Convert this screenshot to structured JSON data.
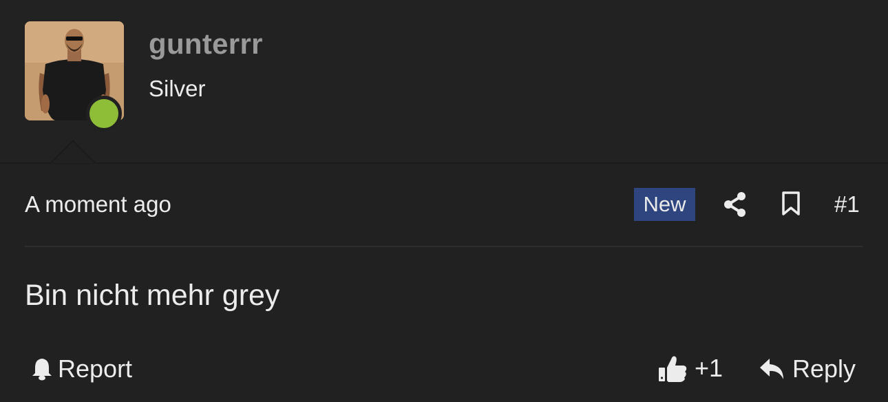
{
  "author": {
    "username": "gunterrr",
    "rank": "Silver",
    "avatar_icon": "user-avatar-photo",
    "online_status_color": "#8ebd37"
  },
  "meta": {
    "timestamp": "A moment ago",
    "new_badge": "New",
    "new_badge_color": "#2f4580",
    "post_number": "#1",
    "share_icon": "share-icon",
    "bookmark_icon": "bookmark-icon"
  },
  "post": {
    "message": "Bin nicht mehr grey"
  },
  "actions": {
    "report_label": "Report",
    "report_icon": "bell-icon",
    "like_count": "+1",
    "like_icon": "thumbs-up-icon",
    "reply_label": "Reply",
    "reply_icon": "reply-icon"
  },
  "colors": {
    "background": "#212121",
    "text": "#ececec",
    "username": "#9a9a9a"
  }
}
